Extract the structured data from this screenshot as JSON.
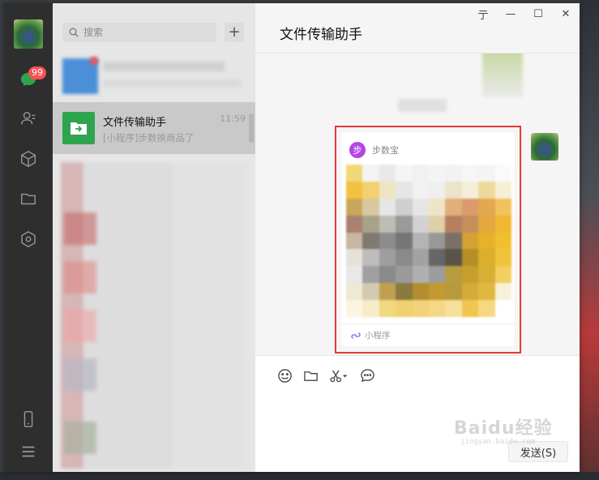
{
  "window": {
    "title": "文件传输助手",
    "controls": [
      "亍",
      "—",
      "☐",
      "✕"
    ]
  },
  "nav": {
    "unread_badge": "99",
    "icons": [
      "chat-icon",
      "contacts-icon",
      "favorites-icon",
      "files-icon",
      "moments-icon",
      "phone-icon",
      "menu-icon"
    ]
  },
  "search": {
    "placeholder": "搜索"
  },
  "chat_list": {
    "active": {
      "name": "文件传输助手",
      "time": "11:59",
      "preview": "[小程序]步数换商品了"
    }
  },
  "message_card": {
    "app_name": "步数宝",
    "app_icon_text": "步",
    "footer_label": "小程序"
  },
  "input": {
    "send_label": "发送(S)"
  },
  "watermark": {
    "text": "Baidu经验",
    "sub": "jingyan.baidu.com"
  },
  "colors": {
    "nav_bg": "#2e2e2e",
    "list_bg": "#e6e6e6",
    "active_item": "#c9c9c9",
    "badge": "#fa5151",
    "highlight_border": "#e53935",
    "file_helper_green": "#2ea44f",
    "app_icon_purple": "#b347e6"
  }
}
